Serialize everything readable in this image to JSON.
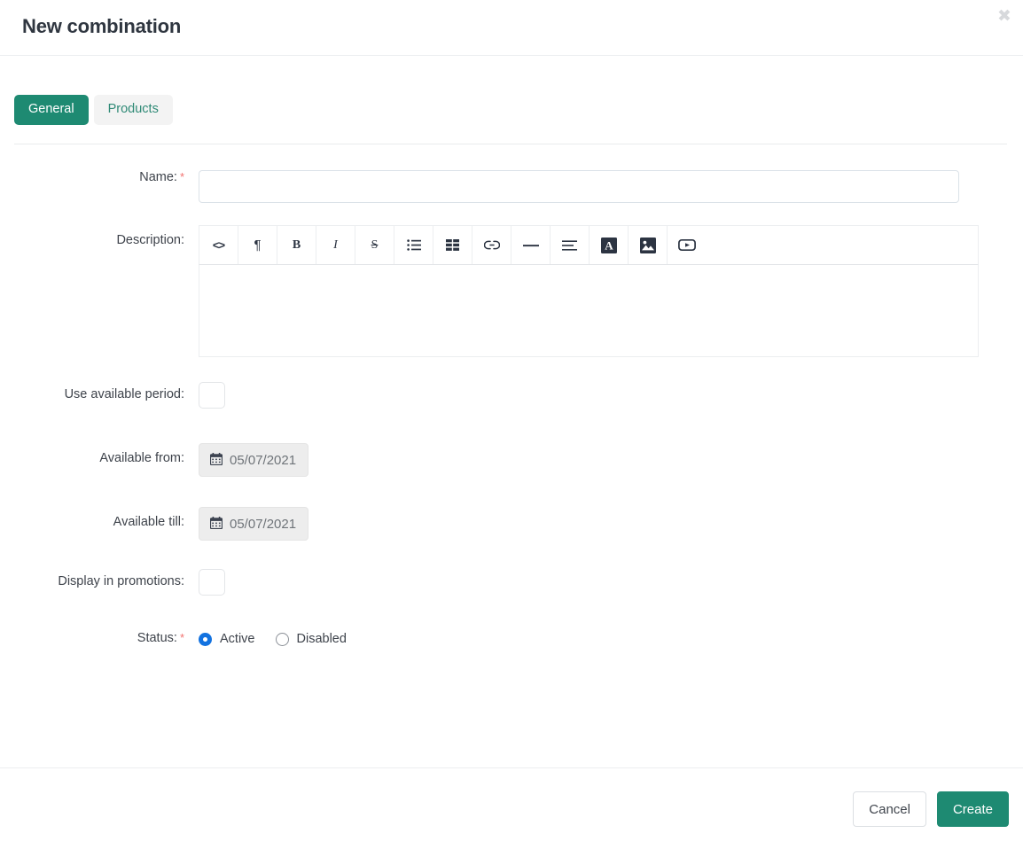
{
  "header": {
    "title": "New combination",
    "close_label": "✖"
  },
  "tabs": [
    {
      "label": "General",
      "active": true
    },
    {
      "label": "Products",
      "active": false
    }
  ],
  "form": {
    "name": {
      "label": "Name:",
      "required_marker": "*",
      "value": "",
      "placeholder": ""
    },
    "description": {
      "label": "Description:",
      "value": "",
      "toolbar": [
        {
          "name": "code-icon",
          "glyph": "<>"
        },
        {
          "name": "paragraph-icon",
          "glyph": "¶"
        },
        {
          "name": "bold-icon",
          "glyph": "B"
        },
        {
          "name": "italic-icon",
          "glyph": "I"
        },
        {
          "name": "strikethrough-icon",
          "glyph": "S"
        },
        {
          "name": "unordered-list-icon",
          "glyph": ""
        },
        {
          "name": "table-icon",
          "glyph": ""
        },
        {
          "name": "link-icon",
          "glyph": ""
        },
        {
          "name": "horizontal-rule-icon",
          "glyph": ""
        },
        {
          "name": "align-icon",
          "glyph": ""
        },
        {
          "name": "text-style-icon",
          "glyph": "A"
        },
        {
          "name": "insert-image-icon",
          "glyph": ""
        },
        {
          "name": "insert-video-icon",
          "glyph": ""
        }
      ]
    },
    "use_available_period": {
      "label": "Use available period:",
      "checked": false
    },
    "available_from": {
      "label": "Available from:",
      "value": "05/07/2021",
      "icon": "calendar-icon"
    },
    "available_till": {
      "label": "Available till:",
      "value": "05/07/2021",
      "icon": "calendar-icon"
    },
    "display_in_promotions": {
      "label": "Display in promotions:",
      "checked": false
    },
    "status": {
      "label": "Status:",
      "required_marker": "*",
      "options": [
        {
          "label": "Active",
          "selected": true
        },
        {
          "label": "Disabled",
          "selected": false
        }
      ]
    }
  },
  "footer": {
    "cancel_label": "Cancel",
    "create_label": "Create"
  },
  "colors": {
    "accent_green": "#1e8a72",
    "required_red": "#f2726f",
    "radio_blue": "#1272e0",
    "tab_inactive_bg": "#f3f3f3"
  }
}
